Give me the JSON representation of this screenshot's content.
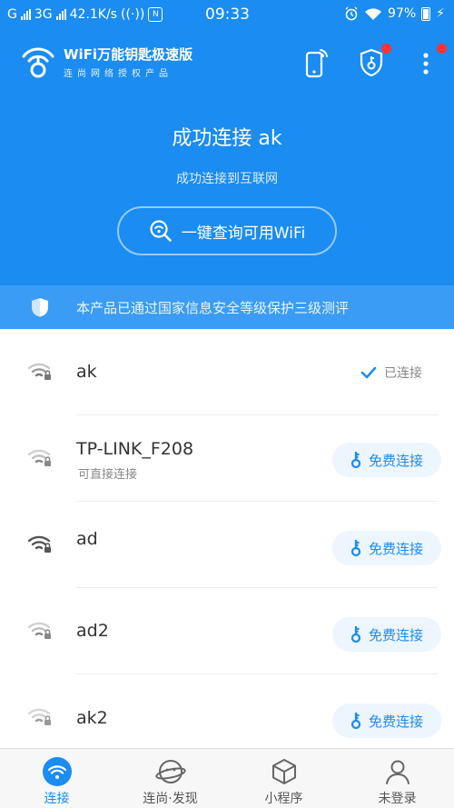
{
  "status_bar": {
    "carrier1": "G",
    "carrier2": "3G",
    "speed": "42.1K/s",
    "time": "09:33",
    "battery": "97%"
  },
  "header": {
    "brand_title": "WiFi万能钥匙极速版",
    "brand_subtitle": "连尚网络授权产品",
    "connection_title": "成功连接 ak",
    "connection_subtitle": "成功连接到互联网",
    "query_button_label": "一键查询可用WiFi",
    "security_notice": "本产品已通过国家信息安全等级保护三级测评"
  },
  "networks": [
    {
      "ssid": "ak",
      "status": "已连接"
    },
    {
      "ssid": "TP-LINK_F208",
      "subtitle": "可直接连接",
      "action": "免费连接"
    },
    {
      "ssid": "ad",
      "action": "免费连接"
    },
    {
      "ssid": "ad2",
      "action": "免费连接"
    },
    {
      "ssid": "ak2",
      "action": "免费连接"
    }
  ],
  "bottom_nav": [
    {
      "label": "连接",
      "icon": "wifi-icon",
      "active": true
    },
    {
      "label": "连尚·发现",
      "icon": "planet-icon"
    },
    {
      "label": "小程序",
      "icon": "cube-icon"
    },
    {
      "label": "未登录",
      "icon": "user-icon"
    }
  ],
  "colors": {
    "primary": "#1a8cf2",
    "badge": "#ff3333"
  }
}
